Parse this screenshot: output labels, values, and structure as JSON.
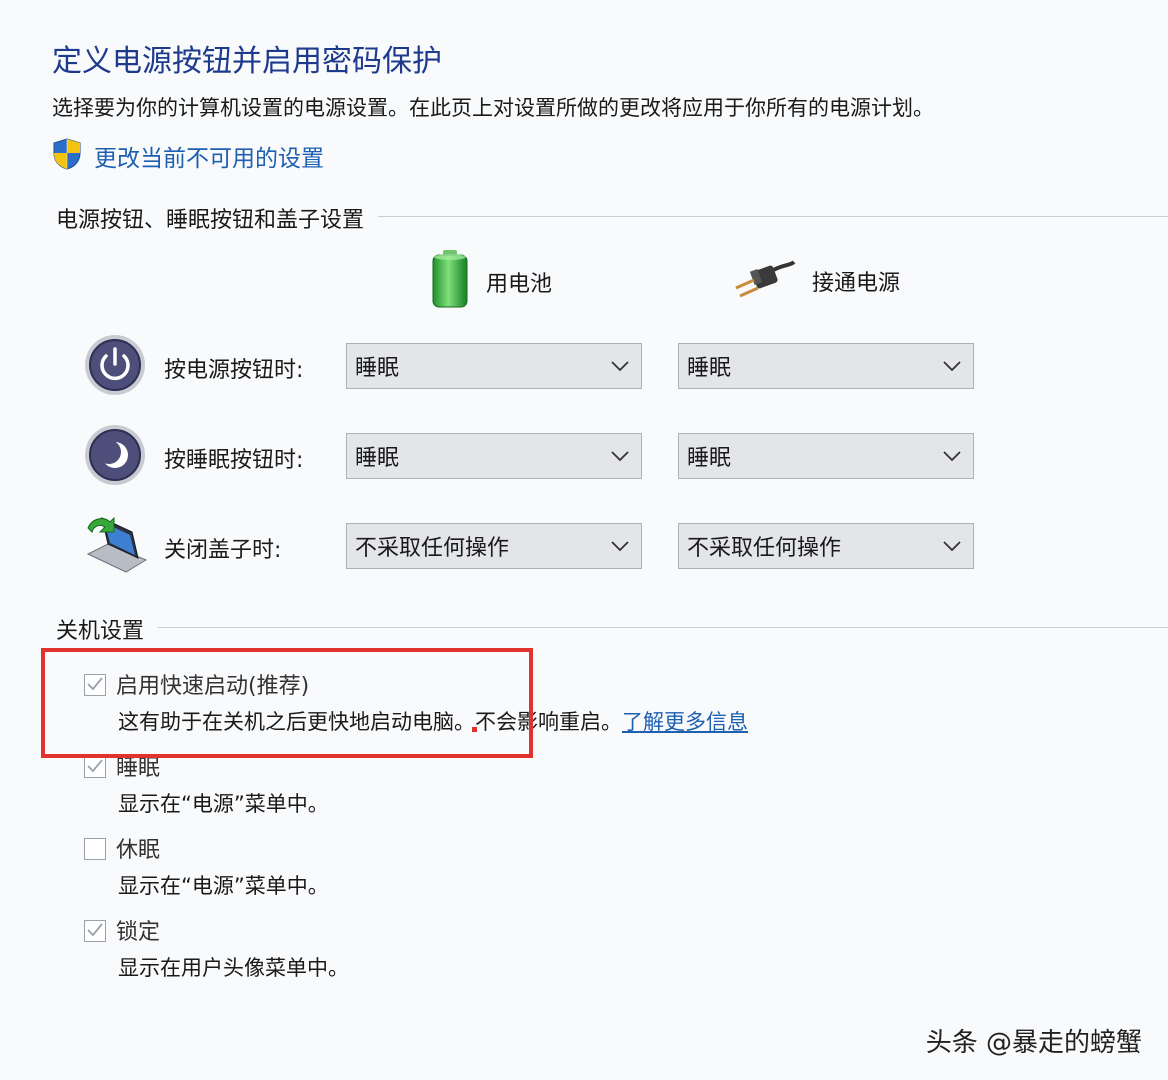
{
  "page": {
    "title": "定义电源按钮并启用密码保护",
    "subtitle": "选择要为你的计算机设置的电源设置。在此页上对设置所做的更改将应用于你所有的电源计划。",
    "change_link": "更改当前不可用的设置"
  },
  "buttons_section": {
    "heading": "电源按钮、睡眠按钮和盖子设置",
    "columns": [
      {
        "label": "用电池",
        "icon": "battery-icon"
      },
      {
        "label": "接通电源",
        "icon": "power-plug-icon"
      }
    ],
    "rows": [
      {
        "label": "按电源按钮时:",
        "icon": "power-button-icon",
        "battery": "睡眠",
        "plugged": "睡眠"
      },
      {
        "label": "按睡眠按钮时:",
        "icon": "sleep-button-icon",
        "battery": "睡眠",
        "plugged": "睡眠"
      },
      {
        "label": "关闭盖子时:",
        "icon": "laptop-lid-icon",
        "battery": "不采取任何操作",
        "plugged": "不采取任何操作"
      }
    ]
  },
  "shutdown_section": {
    "heading": "关机设置",
    "options": [
      {
        "label": "启用快速启动(推荐)",
        "checked": true,
        "disabled": true,
        "desc": "这有助于在关机之后更快地启动电脑。不会影响重启。",
        "link": "了解更多信息"
      },
      {
        "label": "睡眠",
        "checked": true,
        "disabled": true,
        "desc": "显示在“电源”菜单中。"
      },
      {
        "label": "休眠",
        "checked": false,
        "disabled": true,
        "desc": "显示在“电源”菜单中。"
      },
      {
        "label": "锁定",
        "checked": true,
        "disabled": true,
        "desc": "显示在用户头像菜单中。"
      }
    ]
  },
  "watermark": "头条 @暴走的螃蟹",
  "colors": {
    "title": "#1e3a8c",
    "link": "#1d5fb0",
    "highlight": "#e0322e",
    "dropdown_bg": "#e3e5e8",
    "background": "#f9fafc"
  }
}
